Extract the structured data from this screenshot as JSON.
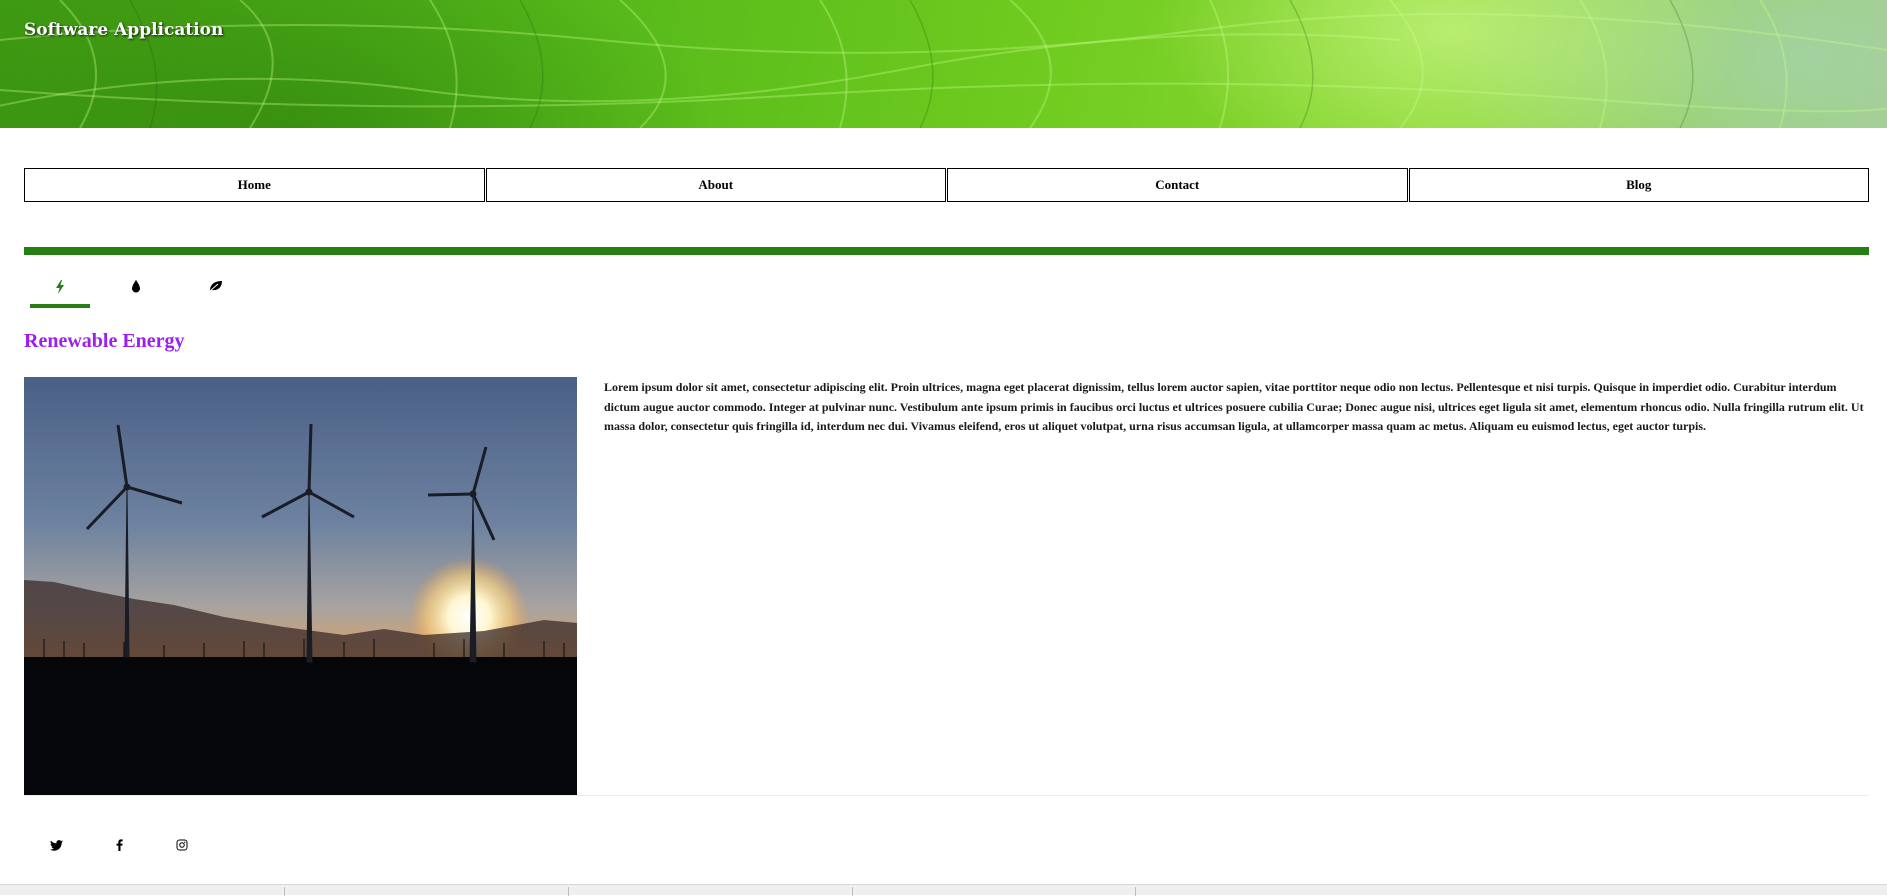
{
  "header": {
    "app_title": "Software Application"
  },
  "nav": {
    "items": [
      {
        "label": "Home"
      },
      {
        "label": "About"
      },
      {
        "label": "Contact"
      },
      {
        "label": "Blog"
      }
    ]
  },
  "tabs": {
    "items": [
      {
        "icon": "bolt-icon",
        "active": true
      },
      {
        "icon": "water-drop-icon",
        "active": false
      },
      {
        "icon": "leaf-icon",
        "active": false
      }
    ]
  },
  "section": {
    "title": "Renewable Energy",
    "image_subject": "wind turbines silhouetted against a sunset",
    "body": "Lorem ipsum dolor sit amet, consectetur adipiscing elit. Proin ultrices, magna eget placerat dignissim, tellus lorem auctor sapien, vitae porttitor neque odio non lectus. Pellentesque et nisi turpis. Quisque in imperdiet odio. Curabitur interdum dictum augue auctor commodo. Integer at pulvinar nunc. Vestibulum ante ipsum primis in faucibus orci luctus et ultrices posuere cubilia Curae; Donec augue nisi, ultrices eget ligula sit amet, elementum rhoncus odio. Nulla fringilla rutrum elit. Ut massa dolor, consectetur quis fringilla id, interdum nec dui. Vivamus eleifend, eros ut aliquet volutpat, urna risus accumsan ligula, at ullamcorper massa quam ac metus. Aliquam eu euismod lectus, eget auctor turpis."
  },
  "social": {
    "items": [
      {
        "icon": "twitter-icon"
      },
      {
        "icon": "facebook-icon"
      },
      {
        "icon": "instagram-icon"
      }
    ]
  },
  "colors": {
    "accent_green": "#267f12",
    "title_purple": "#9b1ff0"
  }
}
